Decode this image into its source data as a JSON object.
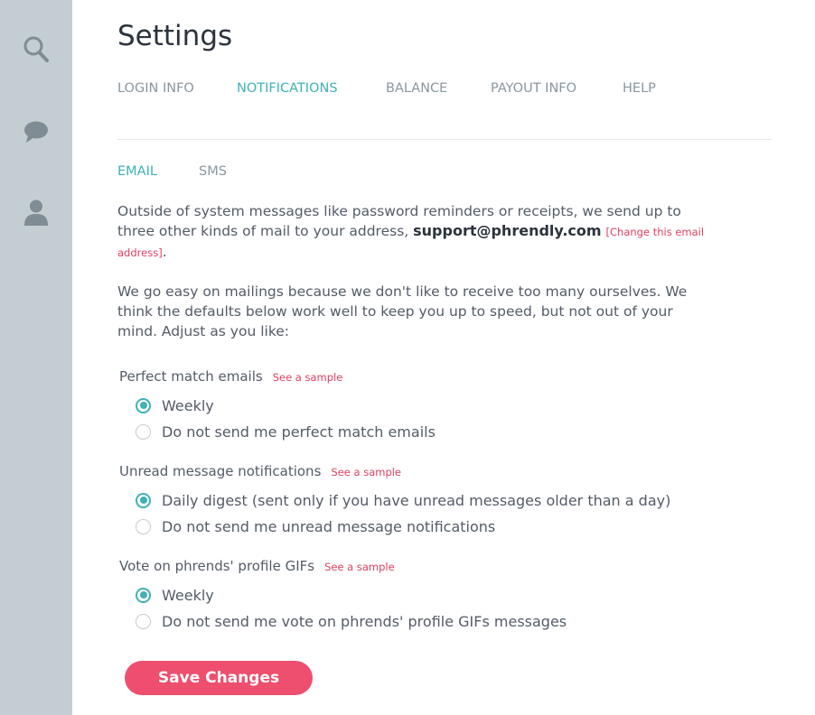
{
  "sidebar": {
    "icons": [
      "search-icon",
      "chat-icon",
      "user-icon"
    ],
    "icon_color": "#7f8c94"
  },
  "page_title": "Settings",
  "tabs": [
    {
      "label": "LOGIN INFO",
      "active": false
    },
    {
      "label": "NOTIFICATIONS",
      "active": true
    },
    {
      "label": "BALANCE",
      "active": false
    },
    {
      "label": "PAYOUT INFO",
      "active": false
    },
    {
      "label": "HELP",
      "active": false
    }
  ],
  "subtabs": [
    {
      "label": "EMAIL",
      "active": true
    },
    {
      "label": "SMS",
      "active": false
    }
  ],
  "intro": {
    "text_before": "Outside of system messages like password reminders or receipts, we send up to three other kinds of mail to your address, ",
    "email": "support@phrendly.com",
    "bracket_open": "[",
    "change_link": "Change this email address",
    "bracket_close": "]",
    "text_after": "."
  },
  "intro2": "We go easy on mailings because we don't like to receive too many ourselves. We think the defaults below work well to keep you up to speed, but not out of your mind. Adjust as you like:",
  "groups": [
    {
      "title": "Perfect match emails",
      "sample_link": "See a sample",
      "options": [
        {
          "label": "Weekly",
          "checked": true
        },
        {
          "label": "Do not send me perfect match emails",
          "checked": false
        }
      ]
    },
    {
      "title": "Unread message notifications",
      "sample_link": "See a sample",
      "options": [
        {
          "label": "Daily digest (sent only if you have unread messages older than a day)",
          "checked": true
        },
        {
          "label": "Do not send me unread message notifications",
          "checked": false
        }
      ]
    },
    {
      "title": "Vote on phrends' profile GIFs",
      "sample_link": "See a sample",
      "options": [
        {
          "label": "Weekly",
          "checked": true
        },
        {
          "label": "Do not send me vote on phrends' profile GIFs messages",
          "checked": false
        }
      ]
    }
  ],
  "save_label": "Save Changes",
  "colors": {
    "accent": "#3fb1b6",
    "link": "#e0405f",
    "button": "#ee4f6e",
    "sidebar": "#c3cdd2"
  }
}
